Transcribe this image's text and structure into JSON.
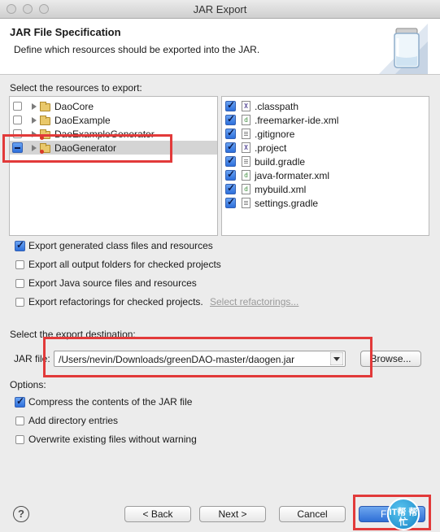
{
  "window": {
    "title": "JAR Export"
  },
  "header": {
    "title": "JAR File Specification",
    "description": "Define which resources should be exported into the JAR."
  },
  "resources": {
    "label": "Select the resources to export:",
    "projects": [
      {
        "label": "DaoCore",
        "state": "unchecked"
      },
      {
        "label": "DaoExample",
        "state": "unchecked"
      },
      {
        "label": "DaoExampleGenerator",
        "state": "unchecked"
      },
      {
        "label": "DaoGenerator",
        "state": "partial",
        "selected": true
      }
    ],
    "files": [
      {
        "label": ".classpath",
        "icon": "xml-x-icon",
        "checked": true
      },
      {
        "label": ".freemarker-ide.xml",
        "icon": "gradle-file-icon",
        "checked": true
      },
      {
        "label": ".gitignore",
        "icon": "text-file-icon",
        "checked": true
      },
      {
        "label": ".project",
        "icon": "xml-x-icon",
        "checked": true
      },
      {
        "label": "build.gradle",
        "icon": "text-file-icon",
        "checked": true
      },
      {
        "label": "java-formater.xml",
        "icon": "gradle-file-icon",
        "checked": true
      },
      {
        "label": "mybuild.xml",
        "icon": "gradle-file-icon",
        "checked": true
      },
      {
        "label": "settings.gradle",
        "icon": "text-file-icon",
        "checked": true
      }
    ]
  },
  "export_options": [
    {
      "label": "Export generated class files and resources",
      "checked": true
    },
    {
      "label": "Export all output folders for checked projects",
      "checked": false
    },
    {
      "label": "Export Java source files and resources",
      "checked": false
    },
    {
      "label": "Export refactorings for checked projects.",
      "checked": false
    }
  ],
  "select_refactorings_link": "Select refactorings...",
  "destination": {
    "label": "Select the export destination:",
    "jar_file_label": "JAR file:",
    "jar_path": "/Users/nevin/Downloads/greenDAO-master/daogen.jar",
    "browse_label": "Browse..."
  },
  "options": {
    "label": "Options:",
    "items": [
      {
        "label": "Compress the contents of the JAR file",
        "checked": true
      },
      {
        "label": "Add directory entries",
        "checked": false
      },
      {
        "label": "Overwrite existing files without warning",
        "checked": false
      }
    ]
  },
  "footer": {
    "help_glyph": "?",
    "back_label": "< Back",
    "next_label": "Next >",
    "cancel_label": "Cancel",
    "finish_label": "Fi",
    "watermark_text": "IT帮 帮忙"
  }
}
